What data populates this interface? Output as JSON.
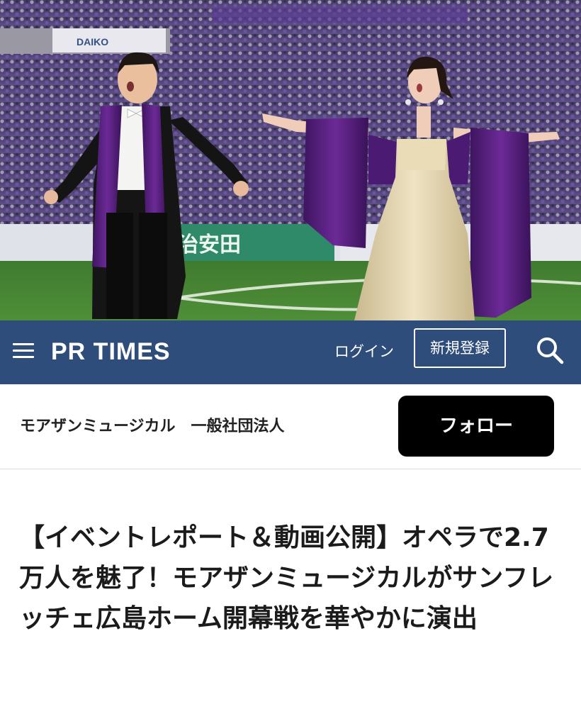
{
  "hero": {
    "banner_text": "治安田",
    "sponsor_text": "DAIKO"
  },
  "header": {
    "logo": "PR TIMES",
    "login_label": "ログイン",
    "register_label": "新規登録",
    "colors": {
      "navbar": "#2f4d7b",
      "text": "#ffffff"
    }
  },
  "company": {
    "name": "モアザンミュージカル　一般社団法人",
    "follow_label": "フォロー"
  },
  "article": {
    "title": "【イベントレポート＆動画公開】オペラで2.7万人を魅了！モアザンミュージカルがサンフレッチェ広島ホーム開幕戦を華やかに演出"
  }
}
